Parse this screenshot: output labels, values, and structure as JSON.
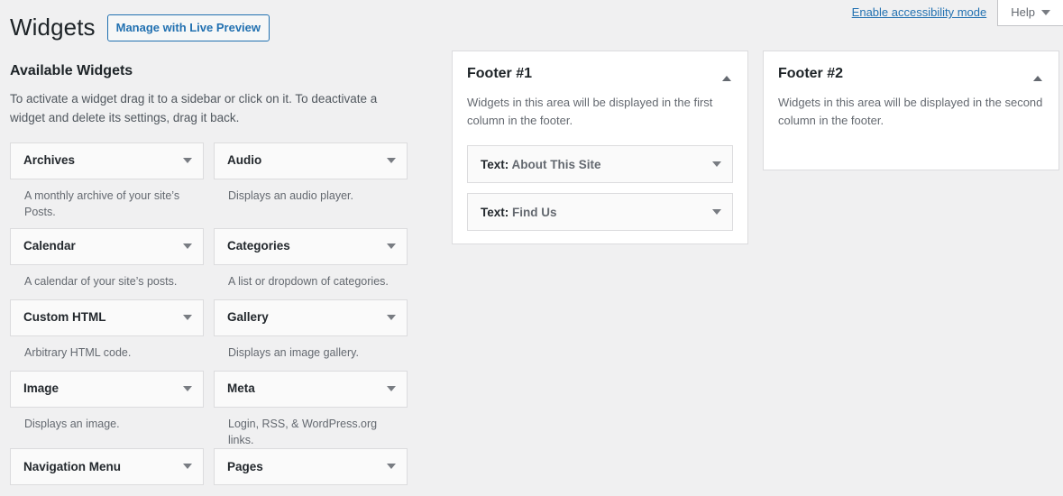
{
  "header": {
    "title": "Widgets",
    "live_preview_label": "Manage with Live Preview",
    "accessibility_link": "Enable accessibility mode",
    "help_label": "Help"
  },
  "available": {
    "heading": "Available Widgets",
    "description": "To activate a widget drag it to a sidebar or click on it. To deactivate a widget and delete its settings, drag it back.",
    "widgets": [
      {
        "name": "Archives",
        "description": "A monthly archive of your site’s Posts."
      },
      {
        "name": "Audio",
        "description": "Displays an audio player."
      },
      {
        "name": "Calendar",
        "description": "A calendar of your site’s posts."
      },
      {
        "name": "Categories",
        "description": "A list or dropdown of categories."
      },
      {
        "name": "Custom HTML",
        "description": "Arbitrary HTML code."
      },
      {
        "name": "Gallery",
        "description": "Displays an image gallery."
      },
      {
        "name": "Image",
        "description": "Displays an image."
      },
      {
        "name": "Meta",
        "description": "Login, RSS, & WordPress.org links."
      },
      {
        "name": "Navigation Menu",
        "description": ""
      },
      {
        "name": "Pages",
        "description": ""
      }
    ]
  },
  "sidebars": [
    {
      "title": "Footer #1",
      "description": "Widgets in this area will be displayed in the first column in the footer.",
      "collapsed": false,
      "widgets": [
        {
          "type": "Text",
          "separator": ": ",
          "title": "About This Site"
        },
        {
          "type": "Text",
          "separator": ": ",
          "title": "Find Us"
        }
      ]
    },
    {
      "title": "Footer #2",
      "description": "Widgets in this area will be displayed in the second column in the footer.",
      "collapsed": false,
      "widgets": []
    }
  ],
  "colors": {
    "page_background": "#f0f0f1",
    "accent_blue": "#2271b1",
    "panel_background": "#ffffff",
    "widget_background": "#fafafa",
    "border": "#dcdcde",
    "text_dark": "#1d2327",
    "text_muted": "#646970"
  }
}
